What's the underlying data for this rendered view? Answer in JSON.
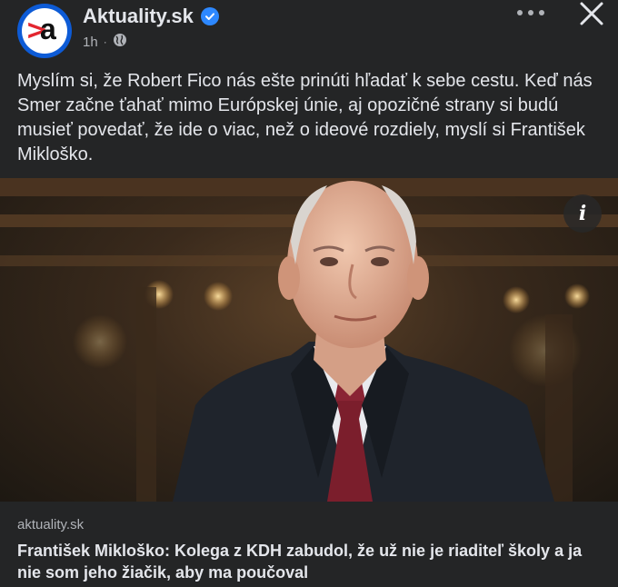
{
  "header": {
    "page_name": "Aktuality.sk",
    "time": "1h",
    "separator": "·",
    "verified": true,
    "avatar_letter": "a",
    "avatar_mark": ">"
  },
  "post": {
    "text": "Myslím si, že Robert Fico nás ešte prinúti hľadať k sebe cestu. Keď nás Smer začne ťahať mimo Európskej únie, aj opozičné strany si budú musieť povedať, že ide o viac, než o ideové rozdiely, myslí si František Mikloško."
  },
  "photo": {
    "info_icon": "i"
  },
  "link_card": {
    "domain": "aktuality.sk",
    "headline": "František Mikloško: Kolega z KDH zabudol, že už nie je riaditeľ školy a ja nie som jeho žiačik, aby ma poučoval"
  },
  "colors": {
    "background": "#242526",
    "text_primary": "#e4e6eb",
    "text_secondary": "#b0b3b8",
    "verified_badge": "#2d88ff",
    "brand_ring": "#0d5bd6",
    "brand_red": "#e3262f"
  },
  "icons": [
    "globe-icon",
    "verified-badge-icon",
    "more-options-icon",
    "close-icon",
    "info-icon"
  ]
}
